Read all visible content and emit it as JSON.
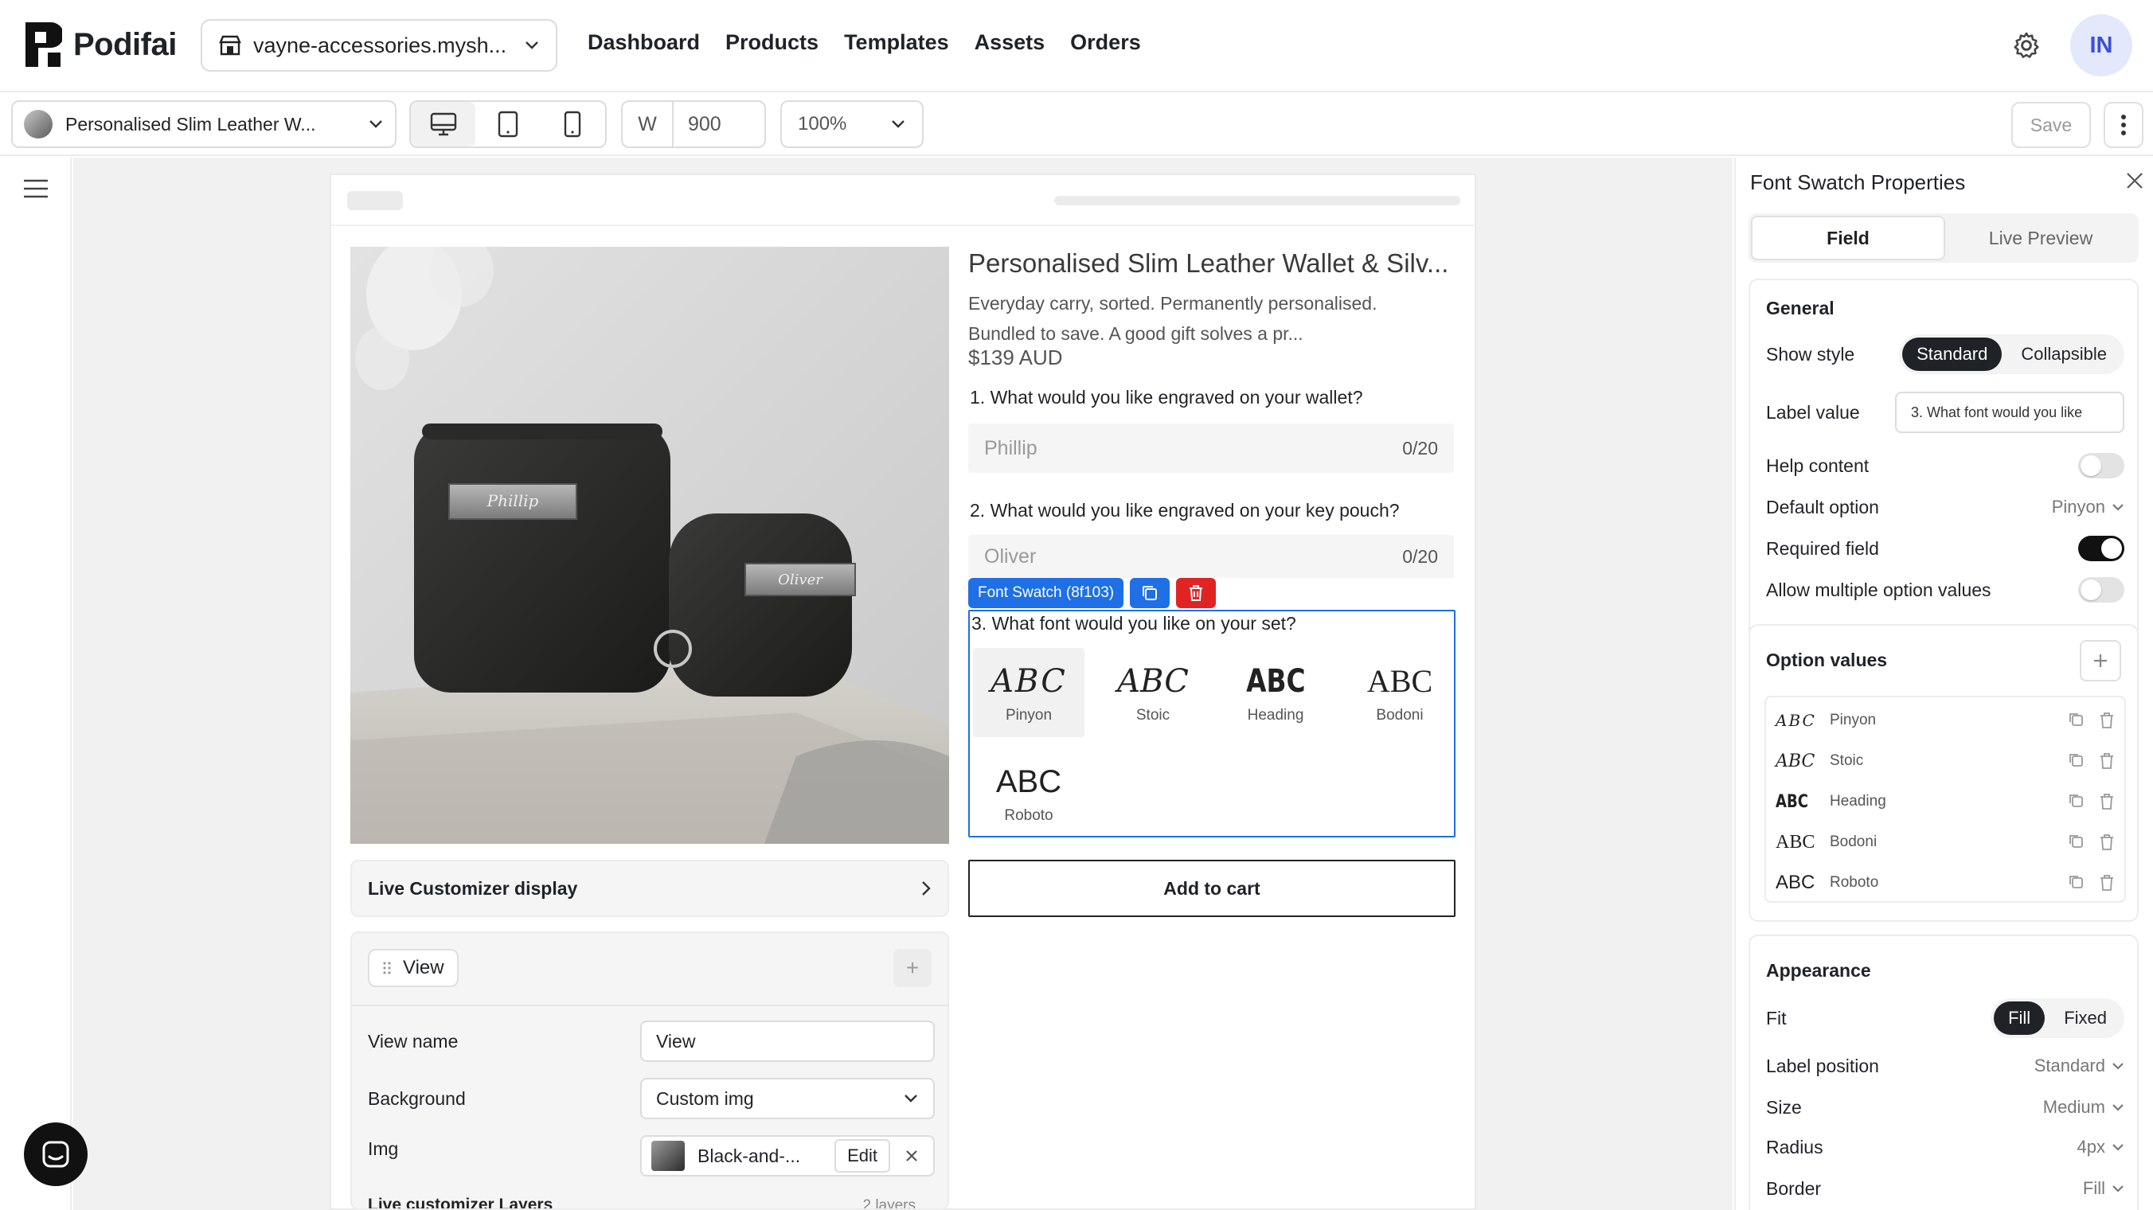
{
  "app": {
    "name": "Podifai",
    "store": "vayne-accessories.mysh...",
    "avatar": "IN"
  },
  "nav": [
    "Dashboard",
    "Products",
    "Templates",
    "Assets",
    "Orders"
  ],
  "toolbar": {
    "product": "Personalised Slim Leather W...",
    "width_label": "W",
    "width_value": "900",
    "zoom": "100%",
    "save": "Save"
  },
  "product": {
    "title": "Personalised Slim Leather Wallet & Silv...",
    "description": "Everyday carry, sorted. Permanently personalised. Bundled to save. A good gift solves a pr...",
    "price": "$139 AUD",
    "q1": "1. What would you like engraved on your wallet?",
    "q1_value": "Phillip",
    "q1_count": "0/20",
    "q2": "2. What would you like engraved on your key pouch?",
    "q2_value": "Oliver",
    "q2_count": "0/20",
    "selection_tag": "Font Swatch (8f103)",
    "q3": "3. What font would you like on your set?",
    "add_to_cart": "Add to cart",
    "engravings": [
      "Phillip",
      "Oliver"
    ]
  },
  "swatches": [
    {
      "glyph": "ABC",
      "name": "Pinyon",
      "selected": true
    },
    {
      "glyph": "ABC",
      "name": "Stoic",
      "selected": false
    },
    {
      "glyph": "ABC",
      "name": "Heading",
      "selected": false
    },
    {
      "glyph": "ABC",
      "name": "Bodoni",
      "selected": false
    },
    {
      "glyph": "ABC",
      "name": "Roboto",
      "selected": false
    }
  ],
  "customizer": {
    "display": "Live Customizer display",
    "view_chip": "View",
    "view_name_label": "View name",
    "view_name_value": "View",
    "background_label": "Background",
    "background_value": "Custom img",
    "img_label": "Img",
    "img_value": "Black-and-...",
    "edit": "Edit",
    "layers_label": "Live customizer Layers",
    "layers_count": "2 layers"
  },
  "panel": {
    "title": "Font Swatch Properties",
    "tabs": [
      "Field",
      "Live Preview"
    ],
    "general": {
      "heading": "General",
      "show_style_label": "Show style",
      "show_style_options": [
        "Standard",
        "Collapsible"
      ],
      "label_value_label": "Label value",
      "label_value": "3. What font would you like",
      "help_content_label": "Help content",
      "help_content": false,
      "default_option_label": "Default option",
      "default_option": "Pinyon",
      "required_label": "Required field",
      "required": true,
      "multiple_label": "Allow multiple option values",
      "multiple": false
    },
    "option_values": {
      "heading": "Option values",
      "items": [
        {
          "glyph": "ABC",
          "name": "Pinyon"
        },
        {
          "glyph": "ABC",
          "name": "Stoic"
        },
        {
          "glyph": "ABC",
          "name": "Heading"
        },
        {
          "glyph": "ABC",
          "name": "Bodoni"
        },
        {
          "glyph": "ABC",
          "name": "Roboto"
        }
      ]
    },
    "appearance": {
      "heading": "Appearance",
      "fit_label": "Fit",
      "fit_options": [
        "Fill",
        "Fixed"
      ],
      "label_position_label": "Label position",
      "label_position": "Standard",
      "size_label": "Size",
      "size": "Medium",
      "radius_label": "Radius",
      "radius": "4px",
      "border_label": "Border",
      "border": "Fill"
    }
  },
  "colors": {
    "accent": "#1f6fe6",
    "danger": "#e02424",
    "dark": "#1f2328"
  }
}
